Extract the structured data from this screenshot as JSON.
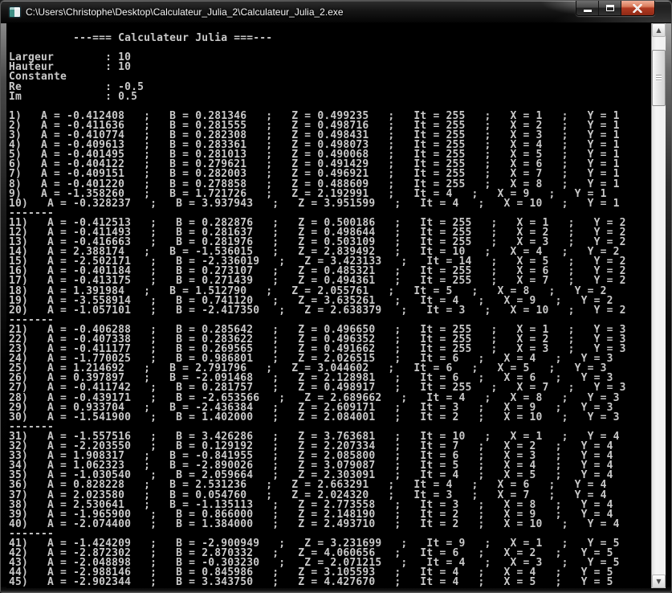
{
  "window": {
    "title": "C:\\Users\\Christophe\\Desktop\\Calculateur_Julia_2\\Calculateur_Julia_2.exe",
    "buttons": {
      "minimize": "minimize",
      "maximize": "maximize",
      "close": "close"
    }
  },
  "colors": {
    "console_bg": "#000000",
    "console_text": "#c9c9c9",
    "close_button": "#b03a22",
    "titlebar": "#161616",
    "scrollbar_track": "#f0f0f0"
  },
  "scrollbar": {
    "up_glyph": "▲",
    "down_glyph": "▼"
  },
  "console": {
    "header": "---=== Calculateur Julia ===---",
    "params": [
      {
        "label": "Largeur",
        "value": "10"
      },
      {
        "label": "Hauteur",
        "value": "10"
      },
      {
        "label": "Constante",
        "value": null
      },
      {
        "label": "Re",
        "value": "-0.5"
      },
      {
        "label": "Im",
        "value": "0.5"
      }
    ],
    "field_labels": {
      "a": "A",
      "b": "B",
      "z": "Z",
      "it": "It",
      "x": "X",
      "y": "Y"
    },
    "separator_char": ";",
    "group_separator": "-------",
    "group_size": 10,
    "rows": [
      [
        "-0.412408",
        "0.281346",
        "0.499235",
        "255",
        "1",
        "1"
      ],
      [
        "-0.411636",
        "0.281555",
        "0.498716",
        "255",
        "2",
        "1"
      ],
      [
        "-0.410774",
        "0.282308",
        "0.498431",
        "255",
        "3",
        "1"
      ],
      [
        "-0.409613",
        "0.283361",
        "0.498073",
        "255",
        "4",
        "1"
      ],
      [
        "-0.401495",
        "0.281013",
        "0.490068",
        "255",
        "5",
        "1"
      ],
      [
        "-0.404122",
        "0.279621",
        "0.491429",
        "255",
        "6",
        "1"
      ],
      [
        "-0.409151",
        "0.282003",
        "0.496921",
        "255",
        "7",
        "1"
      ],
      [
        "-0.401220",
        "0.278858",
        "0.488609",
        "255",
        "8",
        "1"
      ],
      [
        "-1.358260",
        "1.721726",
        "2.192991",
        "4",
        "9",
        "1"
      ],
      [
        "-0.328237",
        "3.937943",
        "3.951599",
        "4",
        "10",
        "1"
      ],
      [
        "-0.412513",
        "0.282876",
        "0.500186",
        "255",
        "1",
        "2"
      ],
      [
        "-0.411493",
        "0.281637",
        "0.498644",
        "255",
        "2",
        "2"
      ],
      [
        "-0.416663",
        "0.281976",
        "0.503109",
        "255",
        "3",
        "2"
      ],
      [
        "2.388174",
        "-1.536015",
        "2.839492",
        "10",
        "4",
        "2"
      ],
      [
        "-2.502171",
        "-2.336019",
        "3.423133",
        "14",
        "5",
        "2"
      ],
      [
        "-0.401184",
        "0.273107",
        "0.485321",
        "255",
        "6",
        "2"
      ],
      [
        "-0.413175",
        "0.271439",
        "0.494361",
        "255",
        "7",
        "2"
      ],
      [
        "1.391984",
        "1.512790",
        "2.055761",
        "5",
        "8",
        "2"
      ],
      [
        "-3.558914",
        "0.741120",
        "3.635261",
        "4",
        "9",
        "2"
      ],
      [
        "-1.057101",
        "-2.417350",
        "2.638379",
        "3",
        "10",
        "2"
      ],
      [
        "-0.406288",
        "0.285642",
        "0.496650",
        "255",
        "1",
        "3"
      ],
      [
        "-0.407338",
        "0.283622",
        "0.496352",
        "255",
        "2",
        "3"
      ],
      [
        "-0.411177",
        "0.269565",
        "0.491662",
        "255",
        "3",
        "3"
      ],
      [
        "-1.770025",
        "0.986801",
        "2.026515",
        "6",
        "4",
        "3"
      ],
      [
        "1.214692",
        "2.791796",
        "3.044602",
        "6",
        "5",
        "3"
      ],
      [
        "0.397897",
        "-2.091468",
        "2.128981",
        "6",
        "6",
        "3"
      ],
      [
        "-0.411742",
        "0.281757",
        "0.498917",
        "255",
        "7",
        "3"
      ],
      [
        "-0.439171",
        "-2.653566",
        "2.689662",
        "4",
        "8",
        "3"
      ],
      [
        "0.933704",
        "-2.436384",
        "2.609171",
        "3",
        "9",
        "3"
      ],
      [
        "-1.541900",
        "1.402000",
        "2.084001",
        "2",
        "10",
        "3"
      ],
      [
        "-1.557516",
        "3.426286",
        "3.763681",
        "10",
        "1",
        "4"
      ],
      [
        "-2.203550",
        "0.129192",
        "2.207334",
        "7",
        "2",
        "4"
      ],
      [
        "1.908317",
        "-0.841955",
        "2.085800",
        "6",
        "3",
        "4"
      ],
      [
        "1.062323",
        "-2.890026",
        "3.079087",
        "5",
        "4",
        "4"
      ],
      [
        "-1.030540",
        "2.059664",
        "2.303091",
        "4",
        "5",
        "4"
      ],
      [
        "0.828228",
        "2.531236",
        "2.663291",
        "4",
        "6",
        "4"
      ],
      [
        "2.023580",
        "0.054760",
        "2.024320",
        "3",
        "7",
        "4"
      ],
      [
        "2.530641",
        "-1.135113",
        "2.773558",
        "3",
        "8",
        "4"
      ],
      [
        "-1.965900",
        "0.866000",
        "2.148190",
        "2",
        "9",
        "4"
      ],
      [
        "-2.074400",
        "1.384000",
        "2.493710",
        "2",
        "10",
        "4"
      ],
      [
        "-1.424209",
        "-2.900949",
        "3.231699",
        "9",
        "1",
        "5"
      ],
      [
        "-2.872302",
        "2.870332",
        "4.060656",
        "6",
        "2",
        "5"
      ],
      [
        "-2.048898",
        "-0.303230",
        "2.071215",
        "4",
        "3",
        "5"
      ],
      [
        "-2.988146",
        "0.845986",
        "3.105593",
        "4",
        "4",
        "5"
      ],
      [
        "-2.902344",
        "3.343750",
        "4.427670",
        "4",
        "5",
        "5"
      ]
    ]
  }
}
